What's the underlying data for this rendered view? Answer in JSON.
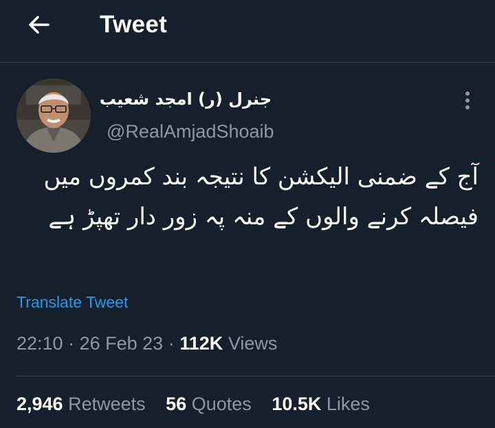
{
  "header": {
    "title": "Tweet"
  },
  "author": {
    "display_name": "جنرل (ر) امجد شعیب",
    "handle": "@RealAmjadShoaib"
  },
  "tweet": {
    "text": "آج کے ضمنی الیکشن کا نتیجہ بند کمروں میں فیصلہ کرنے والوں کے منہ پہ زور دار تھپڑ ہے",
    "translate_label": "Translate Tweet",
    "time": "22:10",
    "separator": "·",
    "date": "26 Feb 23",
    "views_count": "112K",
    "views_label": "Views"
  },
  "stats": {
    "retweets_count": "2,946",
    "retweets_label": "Retweets",
    "quotes_count": "56",
    "quotes_label": "Quotes",
    "likes_count": "10.5K",
    "likes_label": "Likes"
  },
  "colors": {
    "background": "#15202b",
    "text": "#ffffff",
    "secondary_text": "#8b98a5",
    "link": "#1d9bf0",
    "divider": "#38444d"
  }
}
